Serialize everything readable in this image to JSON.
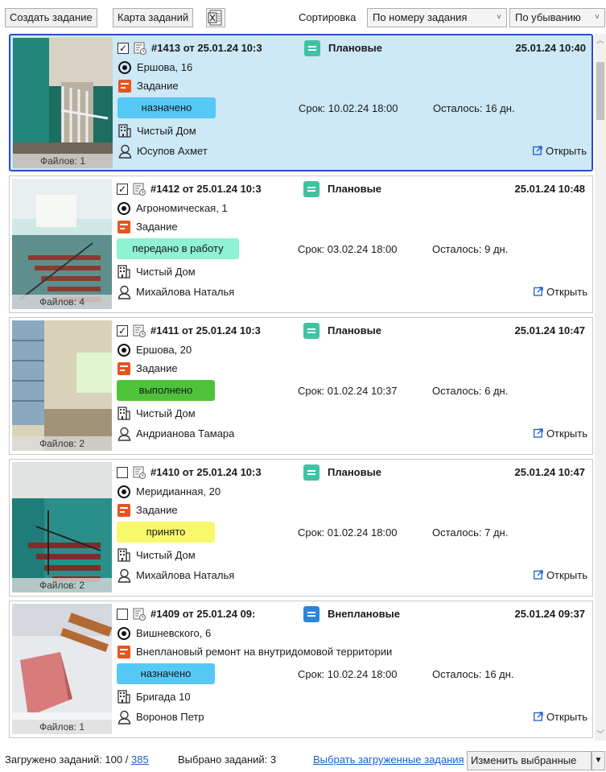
{
  "toolbar": {
    "create_label": "Создать задание",
    "map_label": "Карта заданий",
    "excel_icon": "excel-icon",
    "sort_label": "Сортировка",
    "sort_by": "По номеру задания",
    "sort_order": "По убыванию"
  },
  "colors": {
    "selected_bg": "#cde8f6",
    "selected_border": "#2b4bd6",
    "planned": "#3fc3a3",
    "unplanned": "#2f84d6",
    "assigned": "#55c8f6",
    "in_work": "#8ef2d3",
    "done": "#4ec33a",
    "accepted": "#f8f86a",
    "type": "#e8541e"
  },
  "tasks": [
    {
      "checked": true,
      "check_mark": "✓",
      "number": "#1413 от 25.01.24 10:3",
      "category": "Плановые",
      "category_color": "#3fc3a3",
      "date": "25.01.24 10:40",
      "address": "Ершова, 16",
      "type": "Задание",
      "status": "назначено",
      "status_color": "#55c8f6",
      "deadline": "Срок: 10.02.24 18:00",
      "remaining": "Осталось: 16 дн.",
      "org": "Чистый Дом",
      "person": "Юсупов Ахмет",
      "files": "Файлов: 1",
      "open": "Открыть"
    },
    {
      "checked": true,
      "check_mark": "✓",
      "number": "#1412 от 25.01.24 10:3",
      "category": "Плановые",
      "category_color": "#3fc3a3",
      "date": "25.01.24 10:48",
      "address": "Агрономическая, 1",
      "type": "Задание",
      "status": "передано в работу",
      "status_color": "#8ef2d3",
      "deadline": "Срок: 03.02.24 18:00",
      "remaining": "Осталось: 9 дн.",
      "org": "Чистый Дом",
      "person": "Михайлова Наталья",
      "files": "Файлов: 4",
      "open": "Открыть"
    },
    {
      "checked": true,
      "check_mark": "✓",
      "number": "#1411 от 25.01.24 10:3",
      "category": "Плановые",
      "category_color": "#3fc3a3",
      "date": "25.01.24 10:47",
      "address": "Ершова, 20",
      "type": "Задание",
      "status": "выполнено",
      "status_color": "#4ec33a",
      "deadline": "Срок: 01.02.24 10:37",
      "remaining": "Осталось: 6 дн.",
      "org": "Чистый Дом",
      "person": "Андрианова Тамара",
      "files": "Файлов: 2",
      "open": "Открыть"
    },
    {
      "checked": false,
      "check_mark": "",
      "number": "#1410 от 25.01.24 10:3",
      "category": "Плановые",
      "category_color": "#3fc3a3",
      "date": "25.01.24 10:47",
      "address": "Меридианная, 20",
      "type": "Задание",
      "status": "принято",
      "status_color": "#f8f86a",
      "deadline": "Срок: 01.02.24 18:00",
      "remaining": "Осталось: 7 дн.",
      "org": "Чистый Дом",
      "person": "Михайлова Наталья",
      "files": "Файлов: 2",
      "open": "Открыть"
    },
    {
      "checked": false,
      "check_mark": "",
      "number": "#1409 от 25.01.24 09:",
      "category": "Внеплановые",
      "category_color": "#2f84d6",
      "date": "25.01.24 09:37",
      "address": "Вишневского, 6",
      "type": "Внеплановый ремонт на внутридомовой территории",
      "status": "назначено",
      "status_color": "#55c8f6",
      "deadline": "Срок: 10.02.24 18:00",
      "remaining": "Осталось: 16 дн.",
      "org": "Бригада 10",
      "person": "Воронов Петр",
      "files": "Файлов: 1",
      "open": "Открыть"
    }
  ],
  "footer": {
    "loaded_label": "Загружено заданий: 100 /",
    "loaded_total": "385",
    "selected_label": "Выбрано заданий: 3",
    "select_loaded_link": "Выбрать загруженные задания",
    "change_selected_label": "Изменить выбранные"
  }
}
